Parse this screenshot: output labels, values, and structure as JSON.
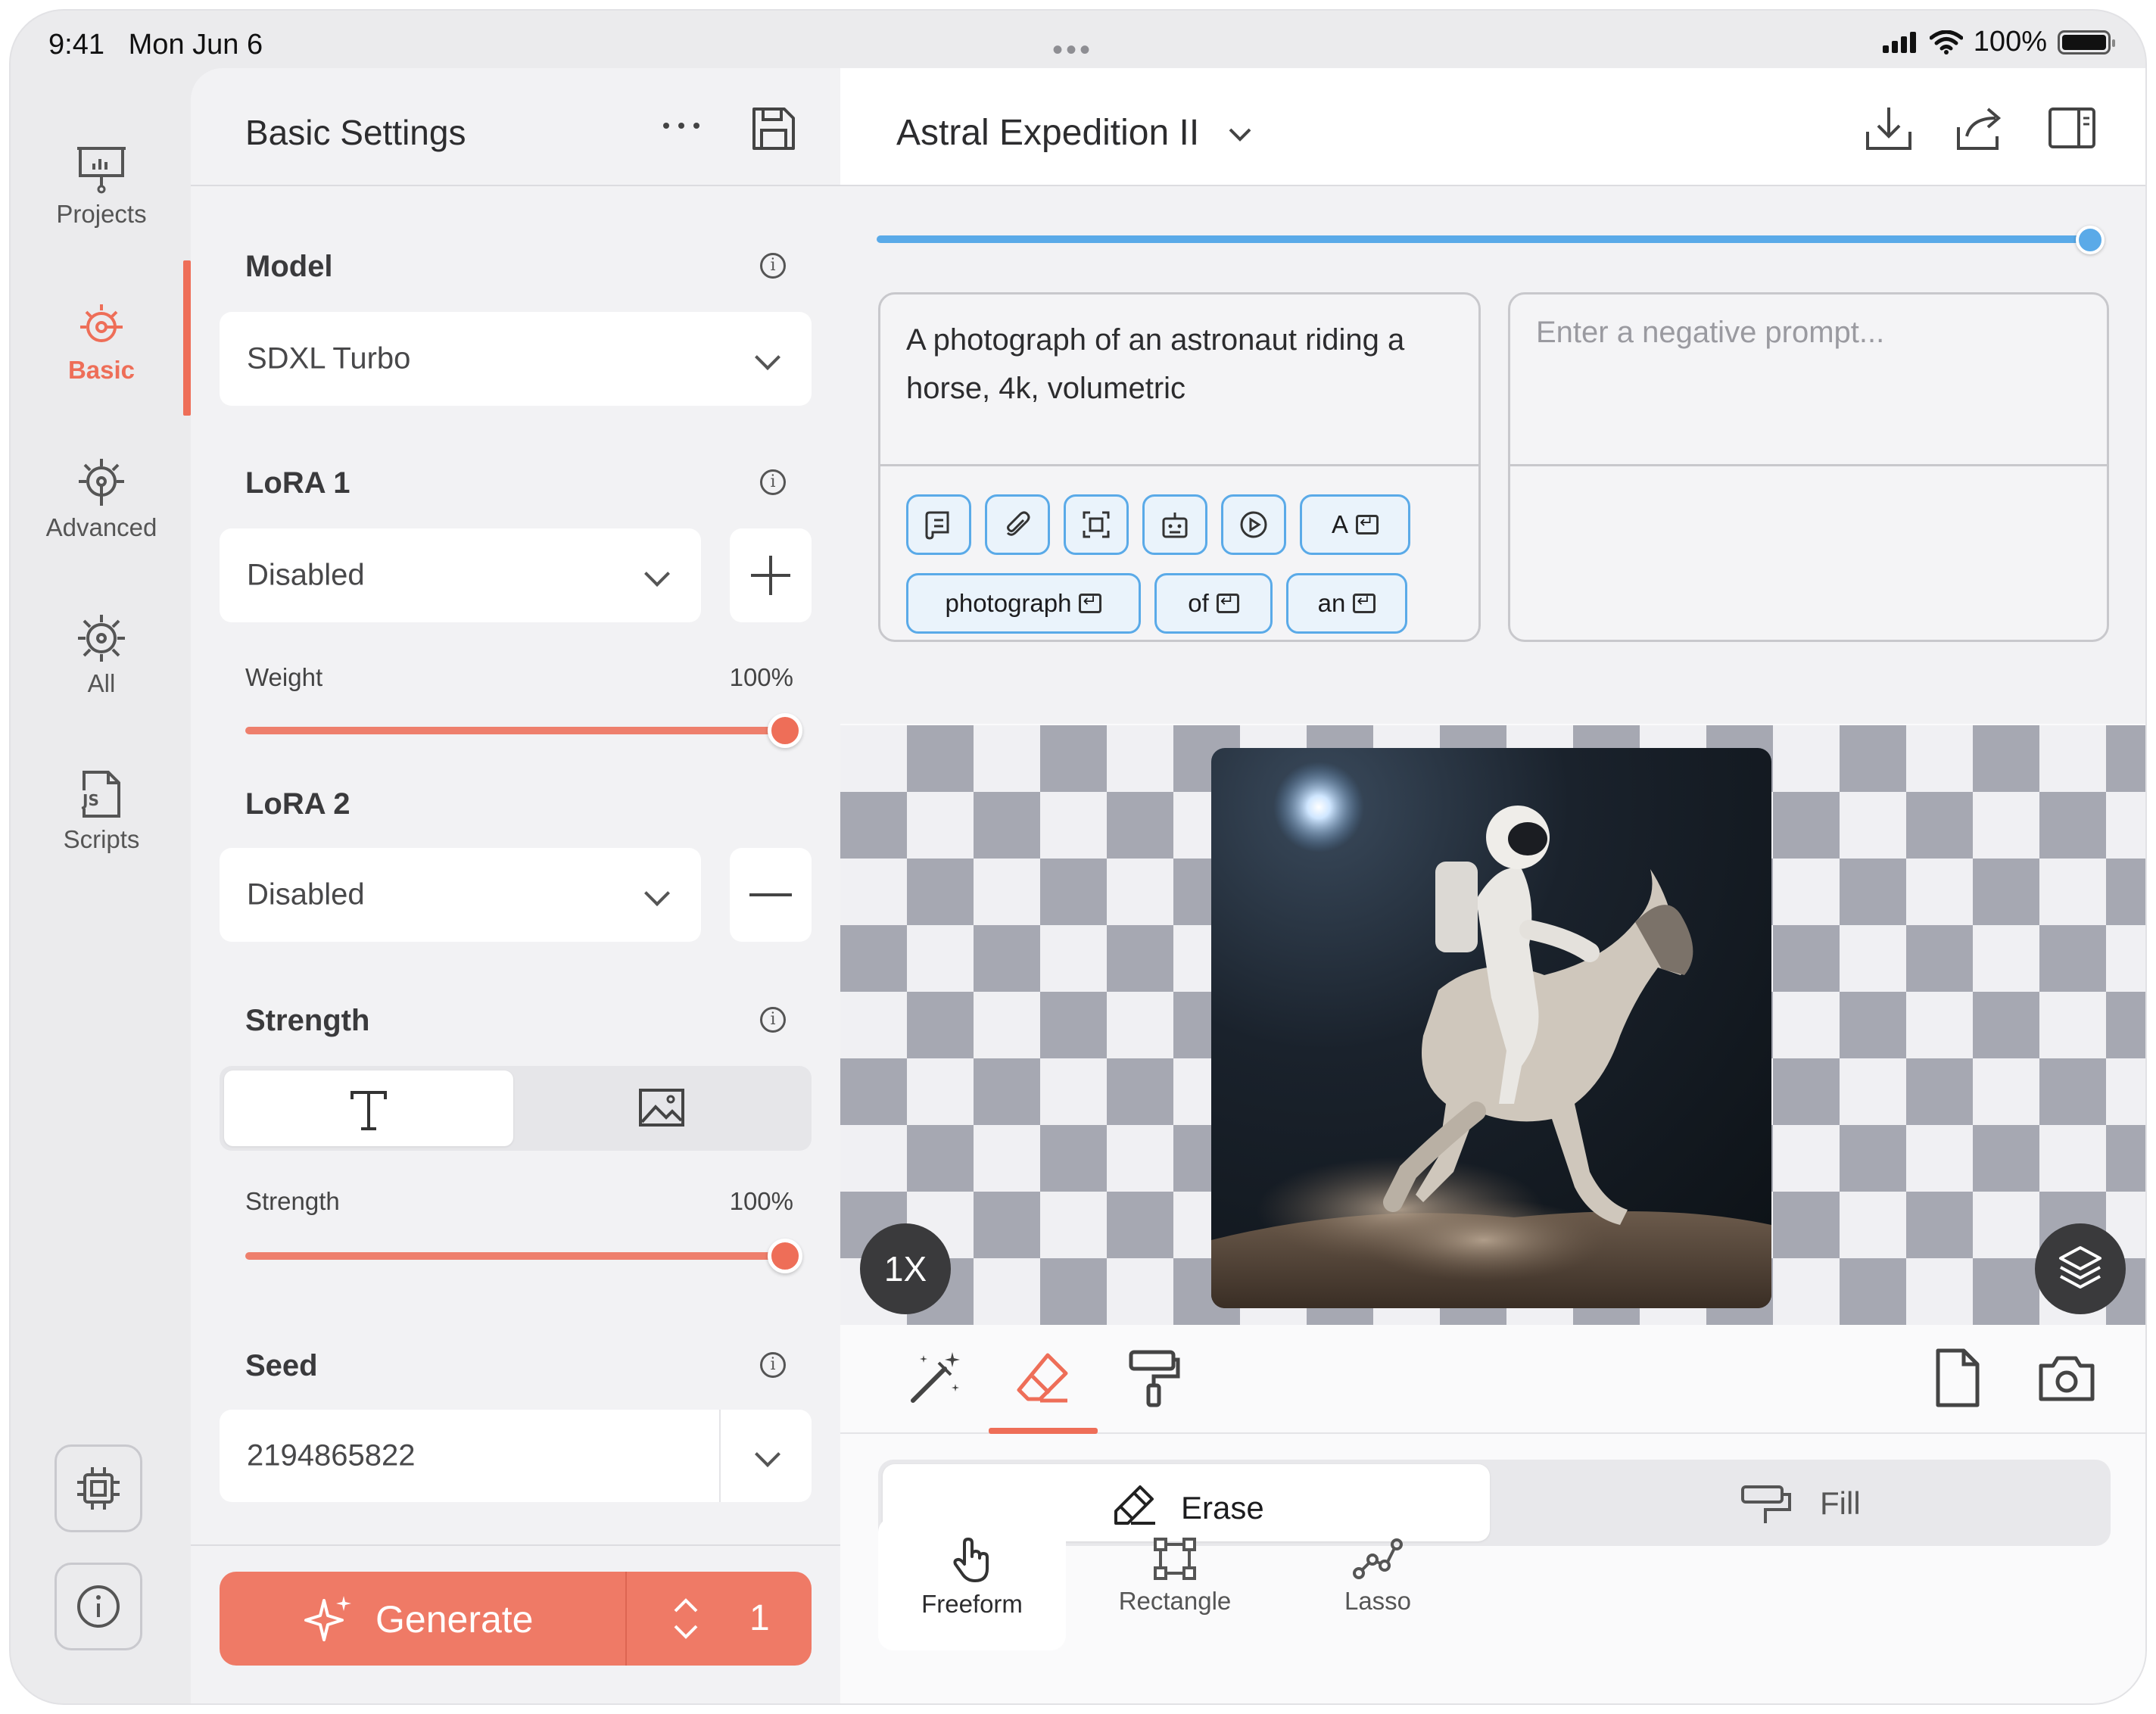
{
  "status_bar": {
    "time": "9:41",
    "date": "Mon Jun 6",
    "battery": "100%"
  },
  "rail": {
    "items": [
      {
        "label": "Projects",
        "icon": "presentation-board-icon"
      },
      {
        "label": "Basic",
        "icon": "target-gear-icon",
        "active": true
      },
      {
        "label": "Advanced",
        "icon": "gear-icon"
      },
      {
        "label": "All",
        "icon": "gear-all-icon"
      },
      {
        "label": "Scripts",
        "icon": "js-file-icon"
      }
    ],
    "bottom_buttons": [
      "cpu-chip-icon",
      "info-icon"
    ]
  },
  "settings": {
    "title": "Basic Settings",
    "model": {
      "label": "Model",
      "value": "SDXL Turbo"
    },
    "lora1": {
      "label": "LoRA 1",
      "value": "Disabled",
      "weight_label": "Weight",
      "weight_value": "100%",
      "weight": 1.0
    },
    "lora2": {
      "label": "LoRA 2",
      "value": "Disabled"
    },
    "strength": {
      "label": "Strength",
      "mode": "text",
      "slider_label": "Strength",
      "slider_value": "100%",
      "level": 1.0
    },
    "seed": {
      "label": "Seed",
      "value": "2194865822"
    },
    "generate": {
      "label": "Generate",
      "count": "1"
    }
  },
  "main": {
    "title": "Astral Expedition II",
    "progress": 1.0,
    "prompt": "A photograph of an astronaut riding a horse, 4k, volumetric",
    "negative_placeholder": "Enter a negative prompt...",
    "chips": [
      "A",
      "photograph",
      "of",
      "an"
    ],
    "zoom": "1X",
    "mode": {
      "erase": "Erase",
      "fill": "Fill",
      "selected": "Erase"
    },
    "selection_tools": [
      {
        "label": "Freeform",
        "icon": "hand-pointer-icon",
        "selected": true
      },
      {
        "label": "Rectangle",
        "icon": "rectangle-select-icon"
      },
      {
        "label": "Lasso",
        "icon": "lasso-icon"
      }
    ]
  },
  "colors": {
    "accent": "#ee6e58",
    "progress_blue": "#5aaae8"
  }
}
